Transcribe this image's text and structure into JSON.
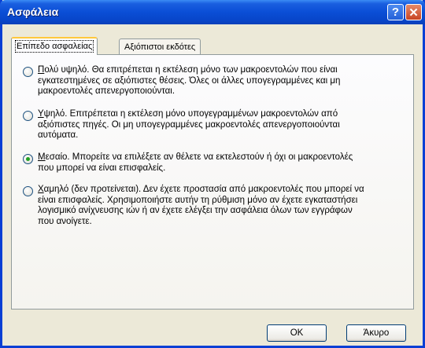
{
  "window": {
    "title": "Ασφάλεια",
    "help_symbol": "?",
    "close_symbol": "✕"
  },
  "tabs": [
    {
      "label": "Επίπεδο ασφαλείας",
      "active": true
    },
    {
      "label": "Αξιόπιστοι εκδότες",
      "active": false
    }
  ],
  "options": [
    {
      "accel": "Π",
      "rest_line1": "ολύ υψηλό. Θα επιτρέπεται η εκτέλεση μόνο των μακροεντολών που είναι",
      "line2": "εγκατεστημένες σε αξιόπιστες θέσεις. Όλες οι άλλες υπογεγραμμένες και μη",
      "line3": "μακροεντολές απενεργοποιούνται.",
      "line4": "",
      "checked": false
    },
    {
      "accel": "Υ",
      "rest_line1": "ψηλό. Επιτρέπεται η εκτέλεση μόνο υπογεγραμμένων μακροεντολών από",
      "line2": "αξιόπιστες πηγές. Οι μη υπογεγραμμένες μακροεντολές απενεργοποιούνται",
      "line3": "αυτόματα.",
      "line4": "",
      "checked": false
    },
    {
      "accel": "Μ",
      "rest_line1": "εσαίο. Μπορείτε να επιλέξετε αν θέλετε να εκτελεστούν ή όχι οι μακροεντολές",
      "line2": "που μπορεί να είναι επισφαλείς.",
      "line3": "",
      "line4": "",
      "checked": true
    },
    {
      "accel": "Χ",
      "rest_line1": "αμηλό (δεν προτείνεται). Δεν έχετε προστασία από μακροεντολές που μπορεί να",
      "line2": "είναι επισφαλείς. Χρησιμοποιήστε αυτήν τη ρύθμιση μόνο αν έχετε εγκαταστήσει",
      "line3": "λογισμικό ανίχνευσης ιών ή αν έχετε ελέγξει την ασφάλεια όλων των εγγράφων",
      "line4": "που ανοίγετε.",
      "checked": false
    }
  ],
  "buttons": {
    "ok": "OK",
    "cancel": "Άκυρο"
  }
}
